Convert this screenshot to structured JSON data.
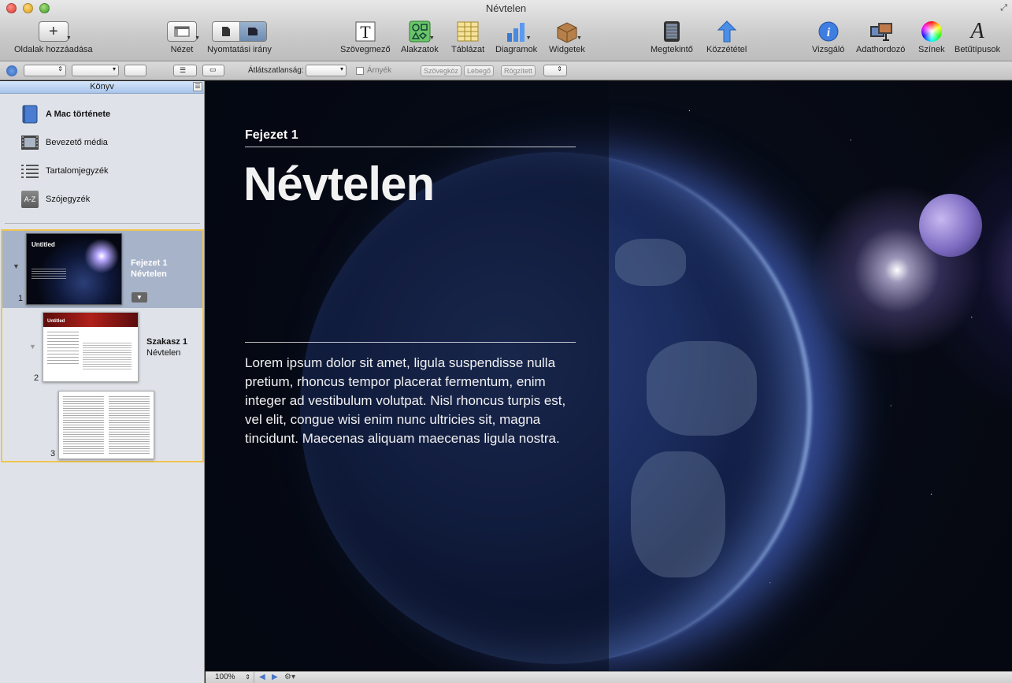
{
  "window": {
    "title": "Névtelen"
  },
  "toolbar": {
    "add_pages": "Oldalak hozzáadása",
    "view": "Nézet",
    "orientation": "Nyomtatási irány",
    "textbox": "Szövegmező",
    "shapes": "Alakzatok",
    "table": "Táblázat",
    "charts": "Diagramok",
    "widgets": "Widgetek",
    "preview": "Megtekintő",
    "publish": "Közzététel",
    "inspector": "Vizsgáló",
    "media": "Adathordozó",
    "colors": "Színek",
    "fonts": "Betűtípusok"
  },
  "formatbar": {
    "opacity_label": "Átlátszatlanság:",
    "shadow_label": "Árnyék",
    "wrap_inline": "Szövegköz",
    "wrap_float": "Lebegő",
    "wrap_anchored": "Rögzített"
  },
  "sidebar": {
    "header": "Könyv",
    "items": [
      {
        "label": "A Mac története",
        "icon": "book-icon"
      },
      {
        "label": "Bevezető média",
        "icon": "film-icon"
      },
      {
        "label": "Tartalomjegyzék",
        "icon": "list-icon"
      },
      {
        "label": "Szójegyzék",
        "icon": "glossary-icon"
      }
    ],
    "pages": [
      {
        "num": "1",
        "title": "Fejezet 1",
        "subtitle": "Névtelen",
        "thumb_title": "Untitled"
      },
      {
        "num": "2",
        "title": "Szakasz 1",
        "subtitle": "Névtelen",
        "thumb_title": "Untitled"
      },
      {
        "num": "3"
      }
    ]
  },
  "canvas": {
    "chapter": "Fejezet 1",
    "title": "Névtelen",
    "body": "Lorem ipsum dolor sit amet, ligula suspendisse nulla pretium, rhoncus tempor placerat fermentum, enim integer ad vestibulum volutpat. Nisl rhoncus turpis est, vel elit, congue wisi enim nunc ultricies sit, magna tincidunt. Maecenas aliquam maecenas ligula nostra."
  },
  "statusbar": {
    "zoom": "100%"
  },
  "colors": {
    "accent": "#f0c450",
    "selected_page_bg": "#a7b3c8",
    "sidebar_bg": "#dfe3e9"
  }
}
